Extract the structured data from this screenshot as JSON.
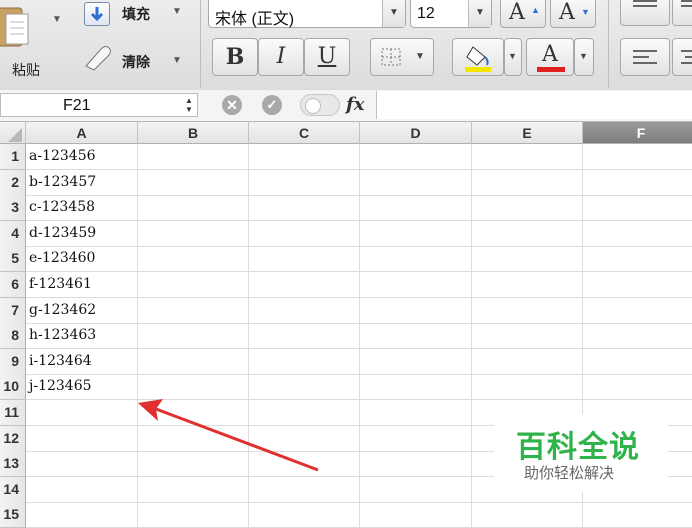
{
  "toolbar": {
    "paste_label": "粘贴",
    "fill_label": "填充",
    "clear_label": "清除",
    "font_name": "宋体 (正文)",
    "font_size": "12",
    "grow_font": "A",
    "shrink_font": "A",
    "bold": "B",
    "italic": "I",
    "underline": "U",
    "font_color": "A",
    "highlight_color": "#f5e600",
    "font_color_value": "#e02020"
  },
  "formula_bar": {
    "name_box": "F21",
    "fx": "fx",
    "content": ""
  },
  "sheet": {
    "columns": [
      "A",
      "B",
      "C",
      "D",
      "E",
      "F"
    ],
    "rows": [
      "1",
      "2",
      "3",
      "4",
      "5",
      "6",
      "7",
      "8",
      "9",
      "10",
      "11",
      "12",
      "13",
      "14",
      "15"
    ],
    "cells_A": [
      "a-123456",
      "b-123457",
      "c-123458",
      "d-123459",
      "e-123460",
      "f-123461",
      "g-123462",
      "h-123463",
      "i-123464",
      "j-123465"
    ]
  },
  "watermark": {
    "title": "百科全说",
    "subtitle": "助你轻松解决"
  },
  "colors": {
    "arrow": "#e03030",
    "watermark_green": "#2fb34a",
    "selected_column": "#8a8a8a"
  }
}
